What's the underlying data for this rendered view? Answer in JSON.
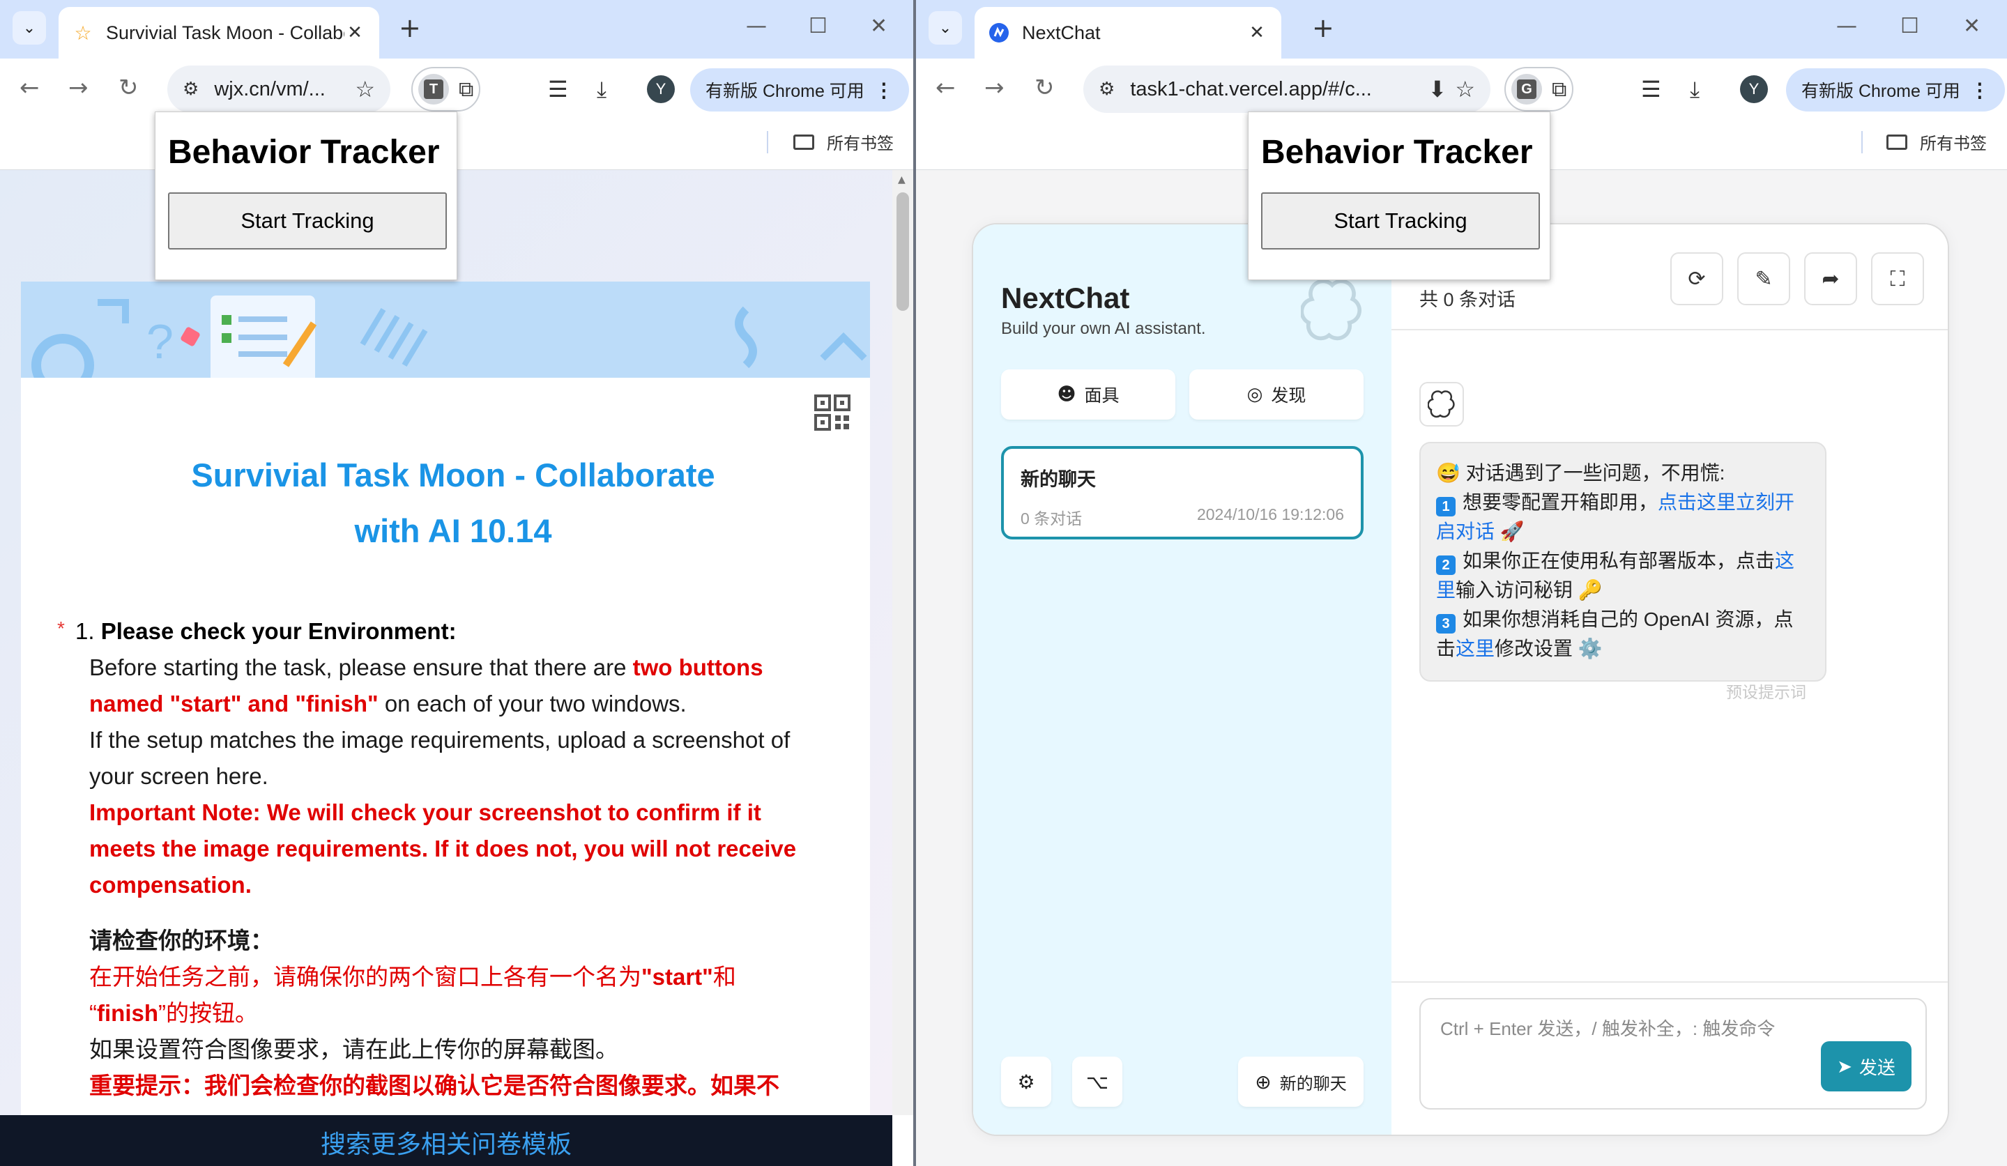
{
  "left_window": {
    "tab": {
      "title": "Survivial Task Moon - Collabo",
      "favicon": "star-favicon-icon"
    },
    "toolbar": {
      "url": "wjx.cn/vm/...",
      "update_label": "有新版 Chrome 可用",
      "avatar_letter": "Y",
      "extension_letter": "T"
    },
    "bookmarks": {
      "all_label": "所有书签"
    },
    "tracker": {
      "title": "Behavior Tracker",
      "button": "Start Tracking"
    },
    "survey": {
      "title_line1": "Survivial Task Moon - Collaborate",
      "title_line2": "with AI 10.14",
      "q_number": "1.",
      "q_title": "Please check your Environment:",
      "p1_a": "Before starting the task, please ensure that there are ",
      "p1_red": "two buttons named \"start\" and \"finish\"",
      "p1_b": " on each of your two windows.",
      "p2": "If the setup matches the image requirements, upload a screenshot of your screen here.",
      "p3_red": "Important Note: We will check your screenshot to confirm if it meets the image requirements. If it does not, you will not receive compensation.",
      "cn_head": "请检查你的环境：",
      "cn_p1_a": "在开始任务之前，请确保你的两个窗口上各有一个名为",
      "cn_p1_start": "\"start\"",
      "cn_p1_b": "和",
      "cn_p1_finish_a": "“",
      "cn_p1_finish": "finish",
      "cn_p1_c": "”的按钮。",
      "cn_p2": "如果设置符合图像要求，请在此上传你的屏幕截图。",
      "cn_p3_red": "重要提示：我们会检查你的截图以确认它是否符合图像要求。如果不"
    },
    "bottom_bar": "搜索更多相关问卷模板"
  },
  "right_window": {
    "tab": {
      "title": "NextChat",
      "favicon": "nextchat-favicon-icon"
    },
    "toolbar": {
      "url": "task1-chat.vercel.app/#/c...",
      "update_label": "有新版 Chrome 可用",
      "avatar_letter": "Y",
      "extension_letter": "G"
    },
    "bookmarks": {
      "all_label": "所有书签"
    },
    "tracker": {
      "title": "Behavior Tracker",
      "button": "Start Tracking"
    },
    "nextchat": {
      "brand": "NextChat",
      "subtitle": "Build your own AI assistant.",
      "mask_button": "面具",
      "discover_button": "发现",
      "chat_item": {
        "title": "新的聊天",
        "count": "0 条对话",
        "date": "2024/10/16 19:12:06"
      },
      "new_chat_button": "新的聊天",
      "header_count": "共 0 条对话",
      "message": {
        "line1": "对话遇到了一些问题，不用慌:",
        "n1": "1",
        "item1_a": "想要零配置开箱即用，",
        "item1_link": "点击这里立刻开启对话",
        "n2": "2",
        "item2_a": "如果你正在使用私有部署版本，点击",
        "item2_link": "这里",
        "item2_b": "输入访问秘钥",
        "n3": "3",
        "item3_a": "如果你想消耗自己的 OpenAI 资源，点击",
        "item3_link": "这里",
        "item3_b": "修改设置"
      },
      "preset_hint": "预设提示词",
      "input_placeholder": "Ctrl + Enter 发送，/ 触发补全，: 触发命令",
      "send_button": "发送"
    }
  }
}
